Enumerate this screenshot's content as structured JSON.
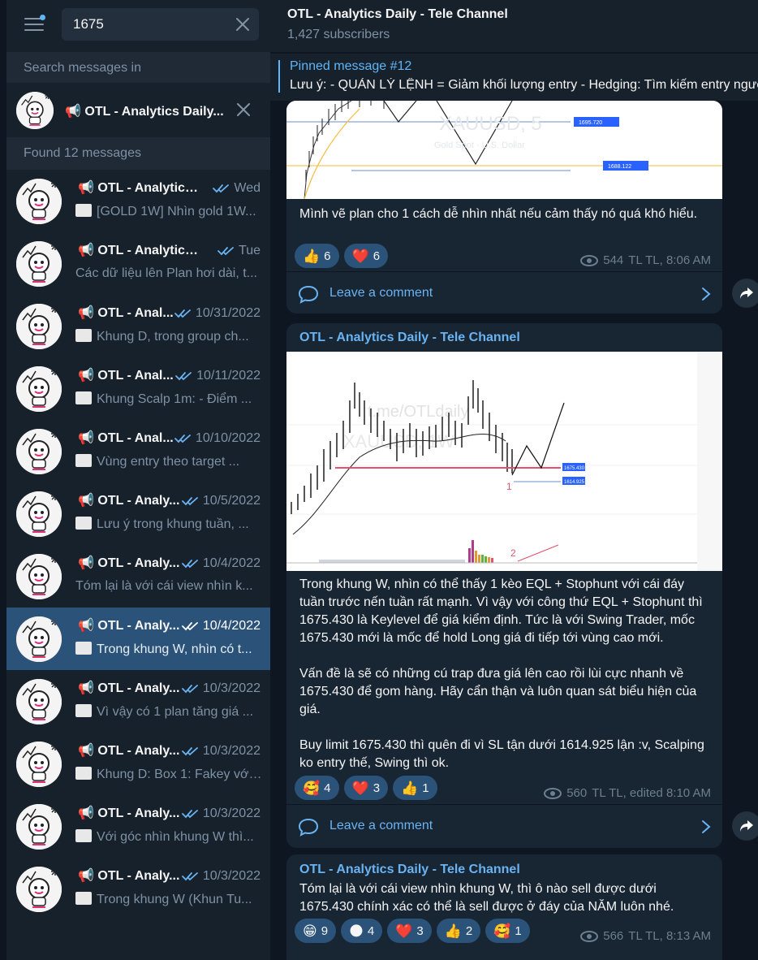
{
  "search": {
    "query": "1675"
  },
  "sidebar": {
    "search_in_label": "Search messages in",
    "filter_chat": "📢 OTL - Analytics Daily...",
    "found_label": "Found 12 messages",
    "results": [
      {
        "title": "📢 OTL - Analytics ...",
        "date": "Wed",
        "preview": "[GOLD 1W] Nhìn gold 1W...",
        "thumb": true
      },
      {
        "title": "📢 OTL - Analytics D...",
        "date": "Tue",
        "preview": "Các dữ liệu lên Plan hơi dài, t...",
        "thumb": false
      },
      {
        "title": "📢 OTL - Anal...",
        "date": "10/31/2022",
        "preview": "Khung D, trong group ch...",
        "thumb": true
      },
      {
        "title": "📢 OTL - Anal...",
        "date": "10/11/2022",
        "preview": "Khung Scalp 1m: - Điểm ...",
        "thumb": true
      },
      {
        "title": "📢 OTL - Anal...",
        "date": "10/10/2022",
        "preview": "Vùng entry theo target ...",
        "thumb": true
      },
      {
        "title": "📢 OTL - Analy...",
        "date": "10/5/2022",
        "preview": "Lưu ý trong khung tuần, ...",
        "thumb": true
      },
      {
        "title": "📢 OTL - Analy...",
        "date": "10/4/2022",
        "preview": "Tóm lại là với cái view nhìn k...",
        "thumb": false
      },
      {
        "title": "📢 OTL - Analy...",
        "date": "10/4/2022",
        "preview": "Trong khung W, nhìn có t...",
        "thumb": true,
        "active": true
      },
      {
        "title": "📢 OTL - Analy...",
        "date": "10/3/2022",
        "preview": "Vì vậy có 1 plan tăng giá ...",
        "thumb": true
      },
      {
        "title": "📢 OTL - Analy...",
        "date": "10/3/2022",
        "preview": "Khung D: Box 1: Fakey với...",
        "thumb": true
      },
      {
        "title": "📢 OTL - Analy...",
        "date": "10/3/2022",
        "preview": "Với góc nhìn khung W thì...",
        "thumb": true
      },
      {
        "title": "📢 OTL - Analy...",
        "date": "10/3/2022",
        "preview": "Trong khung W (Khun Tu...",
        "thumb": true
      }
    ]
  },
  "header": {
    "title": "OTL - Analytics Daily - Tele Channel",
    "subscribers": "1,427 subscribers"
  },
  "pinned": {
    "title": "Pinned message #12",
    "text": "Lưu ý: - QUẢN LÝ LỆNH = Giảm khối lượng entry - Hedging: Tìm kiếm entry ngược"
  },
  "messages": {
    "m1": {
      "chart_symbol": "XAUUSD, 5",
      "chart_desc": "Gold Spot · U.S. Dollar",
      "price_a": "1695.720",
      "price_b": "1688.122",
      "text": "Mình vẽ plan cho 1 cách dễ nhìn nhất nếu cảm thấy nó quá khó hiểu.",
      "reactions": [
        {
          "emoji": "👍",
          "count": "6"
        },
        {
          "emoji": "❤️",
          "count": "6"
        }
      ],
      "views": "544",
      "info": "TL TL, 8:06 AM",
      "comment_label": "Leave a comment"
    },
    "m2": {
      "author": "OTL - Analytics Daily - Tele Channel",
      "watermark": "t.me/OTLdaily",
      "chart_symbol": "XAUUSD, 1W",
      "price_a": "1675.430",
      "price_b": "1614.925",
      "mark_1": "1",
      "mark_2": "2",
      "p1": "Trong khung W, nhìn có thể thấy 1 kèo EQL + Stophunt với cái đáy tuần trước nến tuần rất mạnh. Vì vậy với công thứ EQL + Stophunt thì 1675.430 là Keylevel để giá kiểm định. Tức là với Swing Trader, mốc 1675.430 mới là mốc để hold Long giá đi tiếp tới vùng cao mới.",
      "p2": "Vấn đề là sẽ có những cú trap đưa giá lên cao rồi lùi cực nhanh về 1675.430 để gom hàng. Hãy cẩn thận và luôn quan sát biểu hiện của giá.",
      "p3": "Buy limit 1675.430 thì quên đi vì SL tận dưới 1614.925 lận :v, Scalping ko entry thế, Swing thì ok.",
      "reactions": [
        {
          "emoji": "🥰",
          "count": "4"
        },
        {
          "emoji": "❤️",
          "count": "3"
        },
        {
          "emoji": "👍",
          "count": "1"
        }
      ],
      "views": "560",
      "info": "TL TL, edited 8:10 AM",
      "comment_label": "Leave a comment"
    },
    "m3": {
      "author": "OTL - Analytics Daily - Tele Channel",
      "text": "Tóm lại là với cái view nhìn khung W, thì ô nào sell được dưới 1675.430 chính xác có thể là sell được ở đáy của NĂM luôn nhé.",
      "reactions": [
        {
          "emoji": "😁",
          "count": "9"
        },
        {
          "emoji": "🌑",
          "count": "4"
        },
        {
          "emoji": "❤️",
          "count": "3"
        },
        {
          "emoji": "👍",
          "count": "2"
        },
        {
          "emoji": "🥰",
          "count": "1"
        }
      ],
      "views": "566",
      "info": "TL TL, 8:13 AM"
    }
  },
  "colors": {
    "accent": "#5eb5f7",
    "link": "#6ab3f3",
    "active_row": "#2b5278",
    "panel": "#17212b",
    "bubble": "#182533",
    "bg": "#0e1621"
  }
}
